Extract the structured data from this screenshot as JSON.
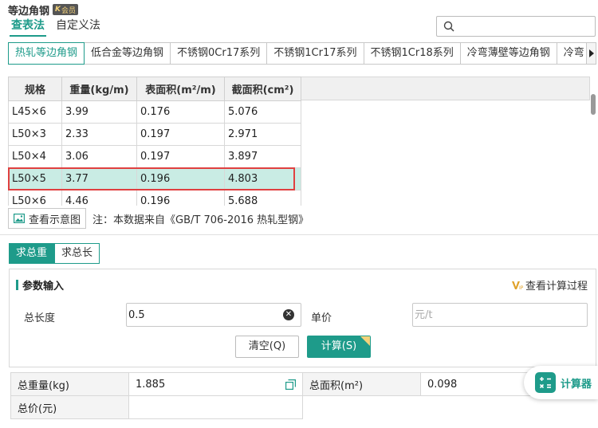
{
  "header": {
    "title": "等边角钢",
    "vip_badge": "会员",
    "vip_mark": "K"
  },
  "mode_tabs": [
    {
      "label": "查表法",
      "active": true
    },
    {
      "label": "自定义法",
      "active": false
    }
  ],
  "search": {
    "placeholder": "",
    "value": ""
  },
  "category_tabs": [
    {
      "label": "热轧等边角钢",
      "active": true
    },
    {
      "label": "低合金等边角钢"
    },
    {
      "label": "不锈钢0Cr17系列"
    },
    {
      "label": "不锈钢1Cr17系列"
    },
    {
      "label": "不锈钢1Cr18系列"
    },
    {
      "label": "冷弯薄壁等边角钢"
    },
    {
      "label": "冷弯"
    }
  ],
  "table": {
    "columns": [
      "规格",
      "重量(kg/m)",
      "表面积(m²/m)",
      "截面积(cm²)"
    ],
    "rows": [
      [
        "L45×6",
        "3.99",
        "0.176",
        "5.076"
      ],
      [
        "L50×3",
        "2.33",
        "0.197",
        "2.971"
      ],
      [
        "L50×4",
        "3.06",
        "0.197",
        "3.897"
      ],
      [
        "L50×5",
        "3.77",
        "0.196",
        "4.803"
      ],
      [
        "L50×6",
        "4.46",
        "0.196",
        "5.688"
      ]
    ],
    "selected_index": 3
  },
  "note": {
    "view_button": "查看示意图",
    "text": "注：本数据来自《GB/T  706-2016  热轧型钢》"
  },
  "calc_tabs": [
    {
      "label": "求总重",
      "active": true
    },
    {
      "label": "求总长",
      "active": false
    }
  ],
  "params": {
    "section_title": "参数输入",
    "view_process": "查看计算过程",
    "length_label": "总长度",
    "length_value": "0.5",
    "price_label": "单价",
    "price_placeholder": "元/t",
    "clear_button": "清空(Q)",
    "calc_button": "计算(S)"
  },
  "results": {
    "total_weight_label": "总重量(kg)",
    "total_weight_value": "1.885",
    "total_area_label": "总面积(m²)",
    "total_area_value": "0.098",
    "total_price_label": "总价(元)",
    "total_price_value": ""
  },
  "calculator": {
    "label": "计算器"
  },
  "colors": {
    "accent": "#1e9b8a",
    "highlight_border": "#e04040",
    "selected_row": "#c9ece4",
    "vip_gold": "#f3d27a"
  }
}
